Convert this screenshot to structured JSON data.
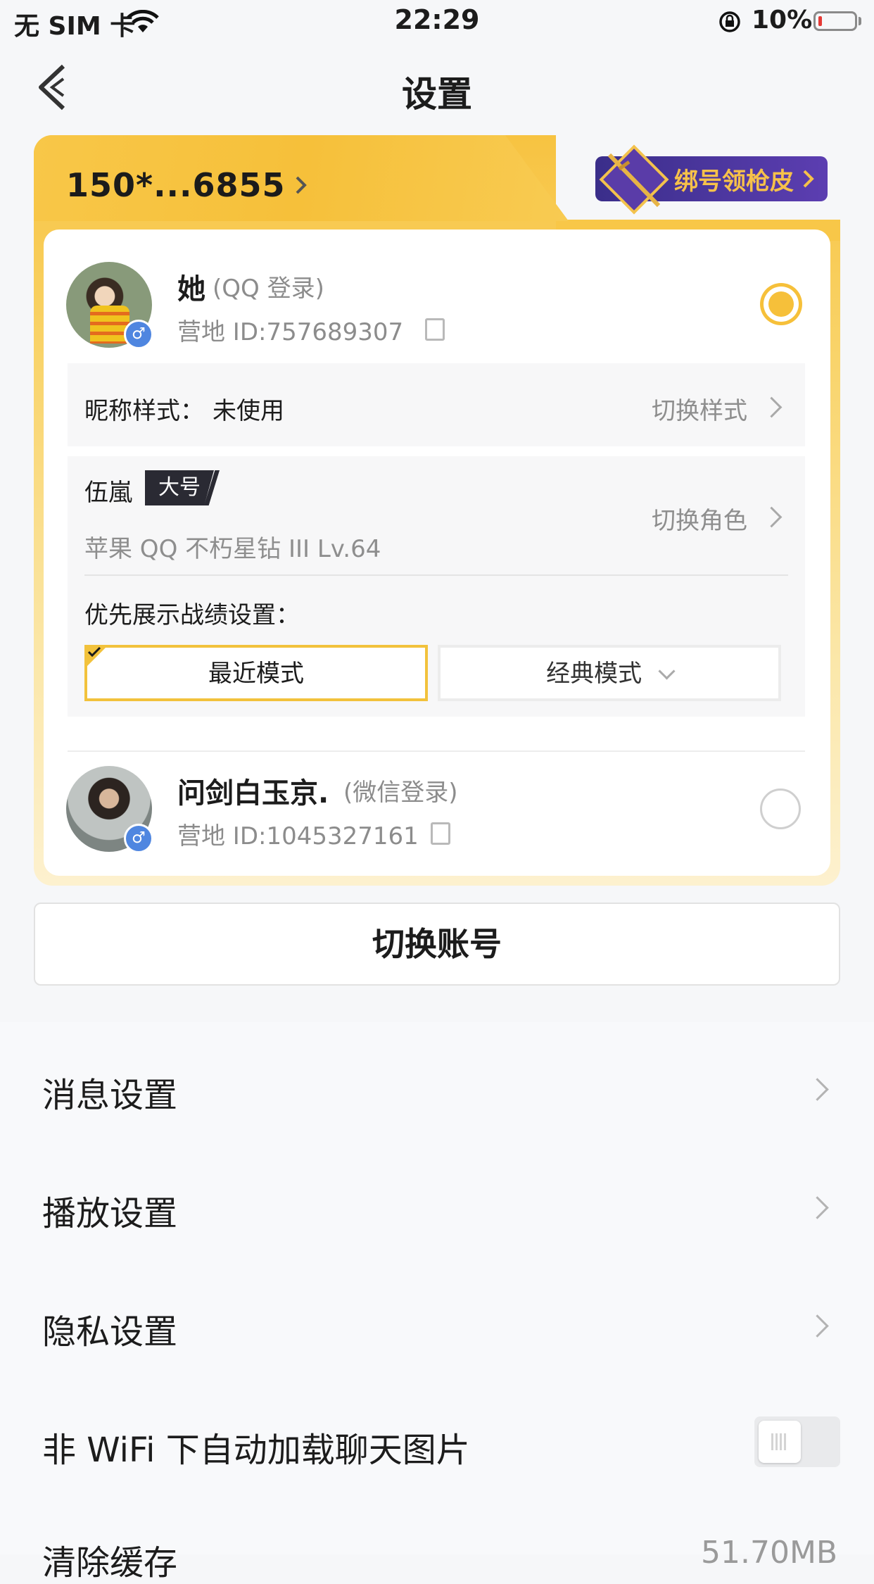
{
  "status_bar": {
    "carrier": "无 SIM 卡",
    "time": "22:29",
    "battery": "10%",
    "battery_level": 0.1
  },
  "nav": {
    "title": "设置"
  },
  "account_card": {
    "phone": "150*...6855",
    "bind_badge": "绑号领枪皮",
    "accounts": [
      {
        "name": "她",
        "login": "(QQ 登录)",
        "camp_id": "营地 ID:757689307",
        "selected": true
      },
      {
        "name": "问剑白玉京.",
        "login": "(微信登录)",
        "camp_id": "营地 ID:1045327161",
        "selected": false
      }
    ],
    "nickname_style": {
      "label": "昵称样式：",
      "value": "未使用",
      "action": "切换样式"
    },
    "role": {
      "name": "伍嵐",
      "tag": "大号",
      "details": "苹果 QQ  不朽星钻 III  Lv.64",
      "action": "切换角色"
    },
    "record": {
      "label": "优先展示战绩设置：",
      "mode_recent": "最近模式",
      "mode_classic": "经典模式"
    }
  },
  "switch_account": "切换账号",
  "settings": [
    {
      "label": "消息设置"
    },
    {
      "label": "播放设置"
    },
    {
      "label": "隐私设置"
    },
    {
      "label": "非 WiFi 下自动加载聊天图片",
      "toggle": false
    },
    {
      "label": "清除缓存",
      "value": "51.70MB"
    }
  ],
  "colors": {
    "accent": "#f6c03a",
    "badge": "#4a38a0",
    "male": "#4f86e0"
  }
}
